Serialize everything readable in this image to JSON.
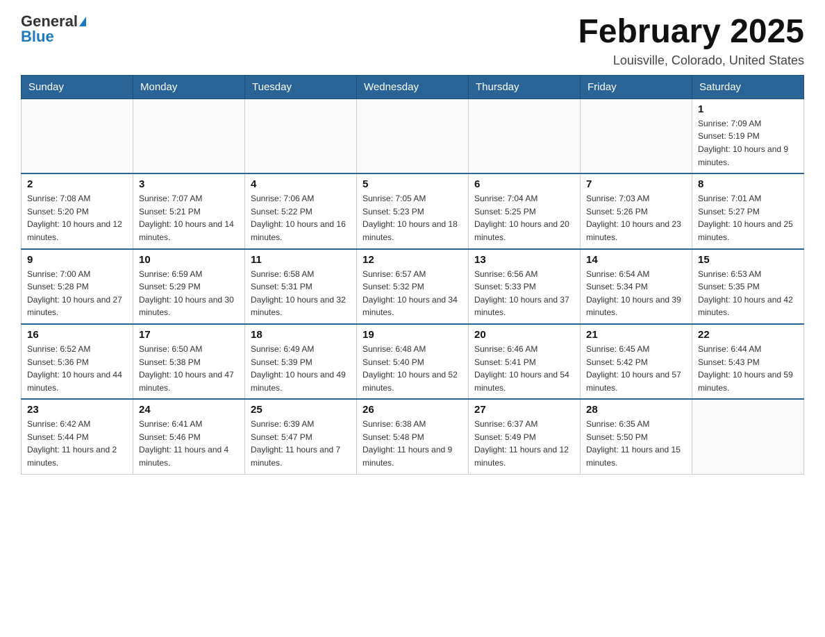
{
  "logo": {
    "general": "General",
    "blue": "Blue"
  },
  "title": "February 2025",
  "location": "Louisville, Colorado, United States",
  "days_of_week": [
    "Sunday",
    "Monday",
    "Tuesday",
    "Wednesday",
    "Thursday",
    "Friday",
    "Saturday"
  ],
  "weeks": [
    [
      {
        "day": "",
        "info": ""
      },
      {
        "day": "",
        "info": ""
      },
      {
        "day": "",
        "info": ""
      },
      {
        "day": "",
        "info": ""
      },
      {
        "day": "",
        "info": ""
      },
      {
        "day": "",
        "info": ""
      },
      {
        "day": "1",
        "info": "Sunrise: 7:09 AM\nSunset: 5:19 PM\nDaylight: 10 hours and 9 minutes."
      }
    ],
    [
      {
        "day": "2",
        "info": "Sunrise: 7:08 AM\nSunset: 5:20 PM\nDaylight: 10 hours and 12 minutes."
      },
      {
        "day": "3",
        "info": "Sunrise: 7:07 AM\nSunset: 5:21 PM\nDaylight: 10 hours and 14 minutes."
      },
      {
        "day": "4",
        "info": "Sunrise: 7:06 AM\nSunset: 5:22 PM\nDaylight: 10 hours and 16 minutes."
      },
      {
        "day": "5",
        "info": "Sunrise: 7:05 AM\nSunset: 5:23 PM\nDaylight: 10 hours and 18 minutes."
      },
      {
        "day": "6",
        "info": "Sunrise: 7:04 AM\nSunset: 5:25 PM\nDaylight: 10 hours and 20 minutes."
      },
      {
        "day": "7",
        "info": "Sunrise: 7:03 AM\nSunset: 5:26 PM\nDaylight: 10 hours and 23 minutes."
      },
      {
        "day": "8",
        "info": "Sunrise: 7:01 AM\nSunset: 5:27 PM\nDaylight: 10 hours and 25 minutes."
      }
    ],
    [
      {
        "day": "9",
        "info": "Sunrise: 7:00 AM\nSunset: 5:28 PM\nDaylight: 10 hours and 27 minutes."
      },
      {
        "day": "10",
        "info": "Sunrise: 6:59 AM\nSunset: 5:29 PM\nDaylight: 10 hours and 30 minutes."
      },
      {
        "day": "11",
        "info": "Sunrise: 6:58 AM\nSunset: 5:31 PM\nDaylight: 10 hours and 32 minutes."
      },
      {
        "day": "12",
        "info": "Sunrise: 6:57 AM\nSunset: 5:32 PM\nDaylight: 10 hours and 34 minutes."
      },
      {
        "day": "13",
        "info": "Sunrise: 6:56 AM\nSunset: 5:33 PM\nDaylight: 10 hours and 37 minutes."
      },
      {
        "day": "14",
        "info": "Sunrise: 6:54 AM\nSunset: 5:34 PM\nDaylight: 10 hours and 39 minutes."
      },
      {
        "day": "15",
        "info": "Sunrise: 6:53 AM\nSunset: 5:35 PM\nDaylight: 10 hours and 42 minutes."
      }
    ],
    [
      {
        "day": "16",
        "info": "Sunrise: 6:52 AM\nSunset: 5:36 PM\nDaylight: 10 hours and 44 minutes."
      },
      {
        "day": "17",
        "info": "Sunrise: 6:50 AM\nSunset: 5:38 PM\nDaylight: 10 hours and 47 minutes."
      },
      {
        "day": "18",
        "info": "Sunrise: 6:49 AM\nSunset: 5:39 PM\nDaylight: 10 hours and 49 minutes."
      },
      {
        "day": "19",
        "info": "Sunrise: 6:48 AM\nSunset: 5:40 PM\nDaylight: 10 hours and 52 minutes."
      },
      {
        "day": "20",
        "info": "Sunrise: 6:46 AM\nSunset: 5:41 PM\nDaylight: 10 hours and 54 minutes."
      },
      {
        "day": "21",
        "info": "Sunrise: 6:45 AM\nSunset: 5:42 PM\nDaylight: 10 hours and 57 minutes."
      },
      {
        "day": "22",
        "info": "Sunrise: 6:44 AM\nSunset: 5:43 PM\nDaylight: 10 hours and 59 minutes."
      }
    ],
    [
      {
        "day": "23",
        "info": "Sunrise: 6:42 AM\nSunset: 5:44 PM\nDaylight: 11 hours and 2 minutes."
      },
      {
        "day": "24",
        "info": "Sunrise: 6:41 AM\nSunset: 5:46 PM\nDaylight: 11 hours and 4 minutes."
      },
      {
        "day": "25",
        "info": "Sunrise: 6:39 AM\nSunset: 5:47 PM\nDaylight: 11 hours and 7 minutes."
      },
      {
        "day": "26",
        "info": "Sunrise: 6:38 AM\nSunset: 5:48 PM\nDaylight: 11 hours and 9 minutes."
      },
      {
        "day": "27",
        "info": "Sunrise: 6:37 AM\nSunset: 5:49 PM\nDaylight: 11 hours and 12 minutes."
      },
      {
        "day": "28",
        "info": "Sunrise: 6:35 AM\nSunset: 5:50 PM\nDaylight: 11 hours and 15 minutes."
      },
      {
        "day": "",
        "info": ""
      }
    ]
  ]
}
